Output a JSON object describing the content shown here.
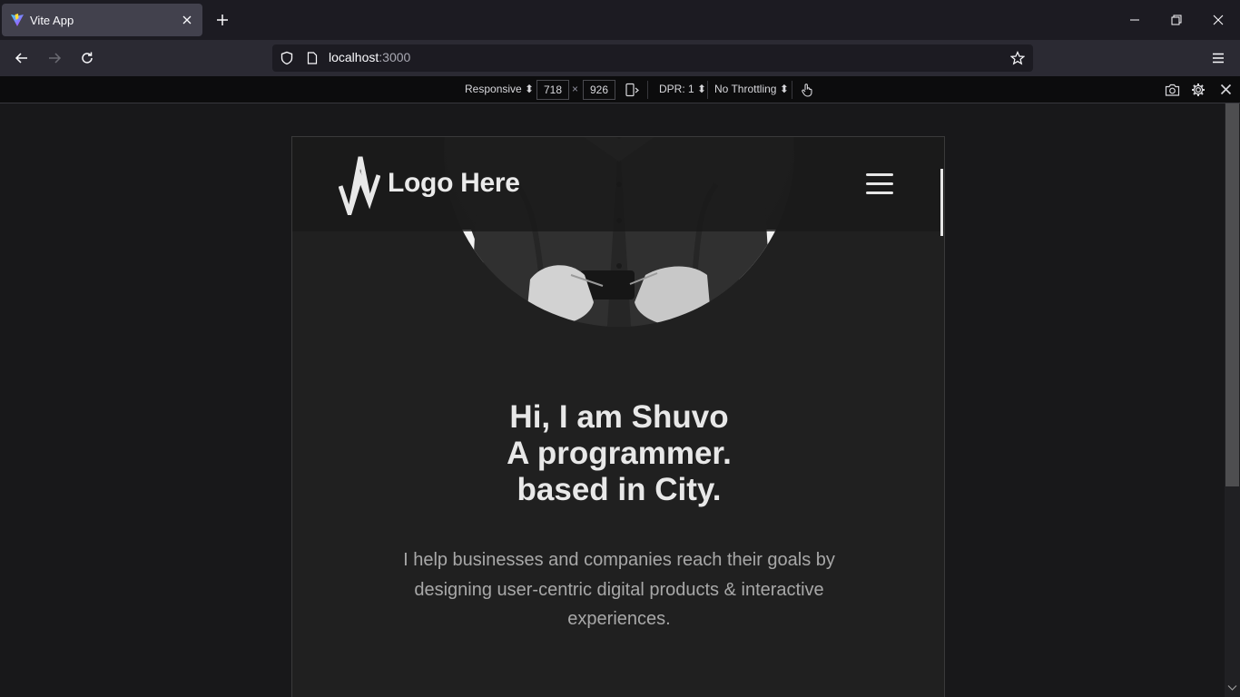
{
  "browser": {
    "tab": {
      "title": "Vite App"
    },
    "url": {
      "host": "localhost",
      "port": ":3000"
    }
  },
  "rdm": {
    "device": "Responsive",
    "width": "718",
    "times": "×",
    "height": "926",
    "dpr": "DPR: 1",
    "throttling": "No Throttling"
  },
  "site": {
    "logo_text": "Logo Here",
    "hero": {
      "line1": "Hi, I am Shuvo",
      "line2": "A programmer.",
      "line3": "based in City.",
      "description": "I help businesses and companies reach their goals by designing user-centric digital products & interactive experiences."
    }
  },
  "colors": {
    "browser_bg": "#1c1b22",
    "toolbar": "#2b2a33",
    "page_bg": "#202020",
    "heading": "#e8e8e8",
    "text_muted": "#a8a8a8"
  }
}
